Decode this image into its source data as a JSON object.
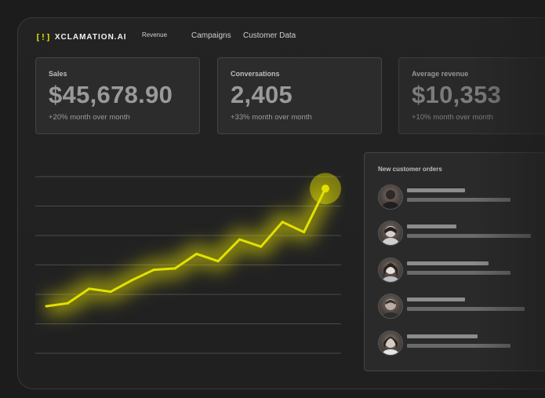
{
  "app": {
    "logo_mark": "[!]",
    "logo_text": "XCLAMATION.AI",
    "accent_color": "#e3e000"
  },
  "nav": {
    "items": [
      {
        "label": "Revenue"
      },
      {
        "label": "Campaigns"
      },
      {
        "label": "Customer Data"
      }
    ]
  },
  "cards": [
    {
      "title": "Sales",
      "value": "$45,678.90",
      "sub": "+20% month over month"
    },
    {
      "title": "Conversations",
      "value": "2,405",
      "sub": "+33% month over month"
    },
    {
      "title": "Average revenue",
      "value": "$10,353",
      "sub": "+10% month over month"
    }
  ],
  "chart_data": {
    "type": "line",
    "title": "",
    "xlabel": "",
    "ylabel": "",
    "grid": true,
    "line_color": "#e3e000",
    "x": [
      0,
      1,
      2,
      3,
      4,
      5,
      6,
      7,
      8,
      9,
      10,
      11,
      12,
      13
    ],
    "values": [
      7,
      9,
      19,
      17,
      25,
      32,
      33,
      43,
      38,
      53,
      48,
      65,
      58,
      88
    ],
    "ylim": [
      0,
      100
    ],
    "highlight_last_point": true
  },
  "orders": {
    "title": "New customer orders",
    "rows": [
      {
        "avatar": "person-avatar"
      },
      {
        "avatar": "person-avatar"
      },
      {
        "avatar": "person-avatar"
      },
      {
        "avatar": "person-avatar"
      },
      {
        "avatar": "person-avatar"
      }
    ]
  }
}
